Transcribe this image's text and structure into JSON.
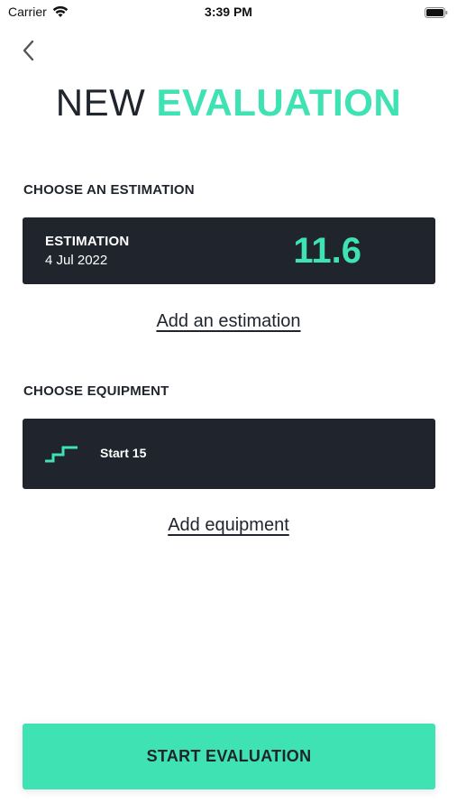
{
  "status_bar": {
    "carrier": "Carrier",
    "time": "3:39 PM",
    "icons": [
      "wifi-icon",
      "battery-icon"
    ]
  },
  "header": {
    "back_icon": "chevron-left-icon",
    "title_light": "NEW",
    "title_accent": "EVALUATION"
  },
  "estimation_section": {
    "heading": "CHOOSE AN ESTIMATION",
    "card": {
      "label": "ESTIMATION",
      "date": "4 Jul 2022",
      "value": "11.6"
    },
    "add_link": "Add an estimation"
  },
  "equipment_section": {
    "heading": "CHOOSE EQUIPMENT",
    "card": {
      "icon": "stairs-icon",
      "label": "Start 15"
    },
    "add_link": "Add equipment"
  },
  "footer": {
    "start_label": "START EVALUATION"
  },
  "colors": {
    "accent": "#3ee2b3",
    "dark": "#1f242d",
    "background": "#ffffff"
  }
}
